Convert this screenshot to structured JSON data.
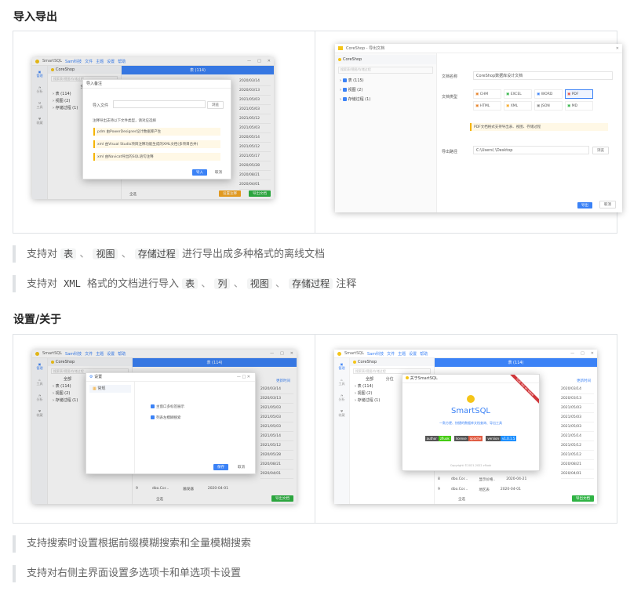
{
  "sections": [
    {
      "heading": "导入导出",
      "quotes": [
        {
          "prefix": "支持对",
          "codes": [
            "表",
            "视图",
            "存储过程"
          ],
          "sep": "、",
          "suffix": "进行导出成多种格式的离线文档"
        },
        {
          "prefix": "支持对",
          "xml": "XML",
          "mid": "格式的文档进行导入",
          "codes": [
            "表",
            "列",
            "视图",
            "存储过程"
          ],
          "sep": "、",
          "suffix": "注释"
        }
      ]
    },
    {
      "heading": "设置/关于",
      "quotes": [
        {
          "text": "支持搜索时设置根据前缀模糊搜索和全量模糊搜索"
        },
        {
          "text": "支持对右侧主界面设置多选项卡和单选项卡设置"
        }
      ]
    }
  ],
  "shot_import": {
    "app_title": "SmartSQL",
    "menu": [
      "Sam科技",
      "文件",
      "主题",
      "设置",
      "帮助"
    ],
    "db": "CoreShop",
    "search_placeholder": "搜索表/视图/存储过程",
    "tab": "表 (114)",
    "filter_label": "全部",
    "tree": [
      "表 (114)",
      "视图 (2)",
      "存储过程 (1)"
    ],
    "rail": [
      "管理",
      "分析",
      "工具",
      "收藏"
    ],
    "dates": [
      "2020/03/14",
      "2020/03/13",
      "2021/05/03",
      "2021/05/03",
      "2021/05/12",
      "2021/05/03",
      "2020/05/14",
      "2021/05/12",
      "2021/05/17",
      "2020/05/28",
      "2020/08/21",
      "2020/04/01"
    ],
    "modal_title": "导入备注",
    "modal_field_label": "导入文件",
    "modal_browse": "浏览",
    "modal_hint": "注释导出支持以下文件类型，请对应选择",
    "modal_tips": [
      "pdm 由PowerDesigner设计数据库产生",
      "xml 由Visual Studio项目注释功能生成的XML文档(多项目合并)",
      "xml 由Navicat导出的SQL语句注释"
    ],
    "modal_ok": "导入",
    "modal_cancel": "取消",
    "footer_all": "全选",
    "footer_btn1": "设置注释",
    "footer_btn2": "导出文档"
  },
  "shot_export": {
    "title": "CoreShop - 导出文档",
    "db": "CoreShop",
    "search_placeholder": "搜索表/视图/存储过程",
    "tree": [
      "表 (115)",
      "视图 (2)",
      "存储过程 (1)"
    ],
    "doc_name_label": "文档名称",
    "doc_name": "CoreShop数据库设计文档",
    "doc_type_label": "文档类型",
    "types": [
      "CHM",
      "EXCEL",
      "WORD",
      "PDF",
      "HTML",
      "XML",
      "JSON",
      "MD"
    ],
    "selected_type": "PDF",
    "tip": "PDF文档格式支持导出表、视图、存储过程",
    "path_label": "导出路径",
    "path": "C:\\Users\\      \\Desktop",
    "browse": "浏览",
    "export": "导出",
    "cancel": "取消"
  },
  "shot_settings": {
    "app_title": "SmartSQL",
    "menu": [
      "Sam科技",
      "文件",
      "主题",
      "设置",
      "帮助"
    ],
    "db": "CoreShop",
    "search_placeholder": "搜索表/视图/存储过程",
    "tab": "表 (114)",
    "tree": [
      "表 (114)",
      "视图 (2)",
      "存储过程 (1)"
    ],
    "rail": [
      "管理",
      "工具",
      "分析",
      "收藏"
    ],
    "filter_label": "全部",
    "col_header": "更新时间",
    "dates": [
      "2020/03/14",
      "2020/03/13",
      "2021/05/03",
      "2021/05/03",
      "2021/05/03",
      "2021/05/14",
      "2021/05/12",
      "2020/05/28",
      "2020/08/21",
      "2020/04/01"
    ],
    "modal_title": "设置",
    "nav_item": "常规",
    "options": [
      "主窗口多标签展示",
      "列表左模糊搜索"
    ],
    "save": "保存",
    "cancel": "取消",
    "last_row": {
      "num": "9",
      "name": "dbo.Cor...",
      "type": "触发器",
      "date": "2020-04-01"
    },
    "footer_all": "全选",
    "footer_btn": "导出文档"
  },
  "shot_about": {
    "app_title": "SmartSQL",
    "menu": [
      "Sam科技",
      "文件",
      "主题",
      "设置",
      "帮助"
    ],
    "db": "CoreShop",
    "search_placeholder": "搜索表/视图/存储过程",
    "tab": "表 (114)",
    "tree": [
      "表 (114)",
      "视图 (2)",
      "存储过程 (1)"
    ],
    "rail": [
      "管理",
      "工具",
      "分析",
      "收藏"
    ],
    "filter_label": "全部",
    "col2": "分位",
    "col_header": "更新时间",
    "dates": [
      "2020/03/14",
      "2020/03/13",
      "2021/05/03",
      "2021/05/03",
      "2021/05/03",
      "2021/05/14",
      "2021/05/12",
      "2021/05/12",
      "2020/08/21",
      "2020/04/01"
    ],
    "about_title": "关于SmartSQL",
    "app_name": "SmartSQL",
    "slogan": "一款方便、快捷的数据库文档查询、导出工具",
    "badges": [
      {
        "k": "author",
        "v": "zfluok"
      },
      {
        "k": "license",
        "v": "apache"
      },
      {
        "k": "version",
        "v": "v1.0.1.5"
      }
    ],
    "copyright": "Copyright ©2021-2022 zfluok",
    "ribbon": "Fork me on Gitee",
    "rows": [
      {
        "num": "8",
        "name": "dbo.Cor...",
        "type": "显示价格..",
        "date": "2020-04-21"
      },
      {
        "num": "9",
        "name": "dbo.Cor...",
        "type": "地区表",
        "date": "2020-04-01"
      }
    ],
    "footer_all": "全选",
    "footer_btn": "导出文档"
  }
}
